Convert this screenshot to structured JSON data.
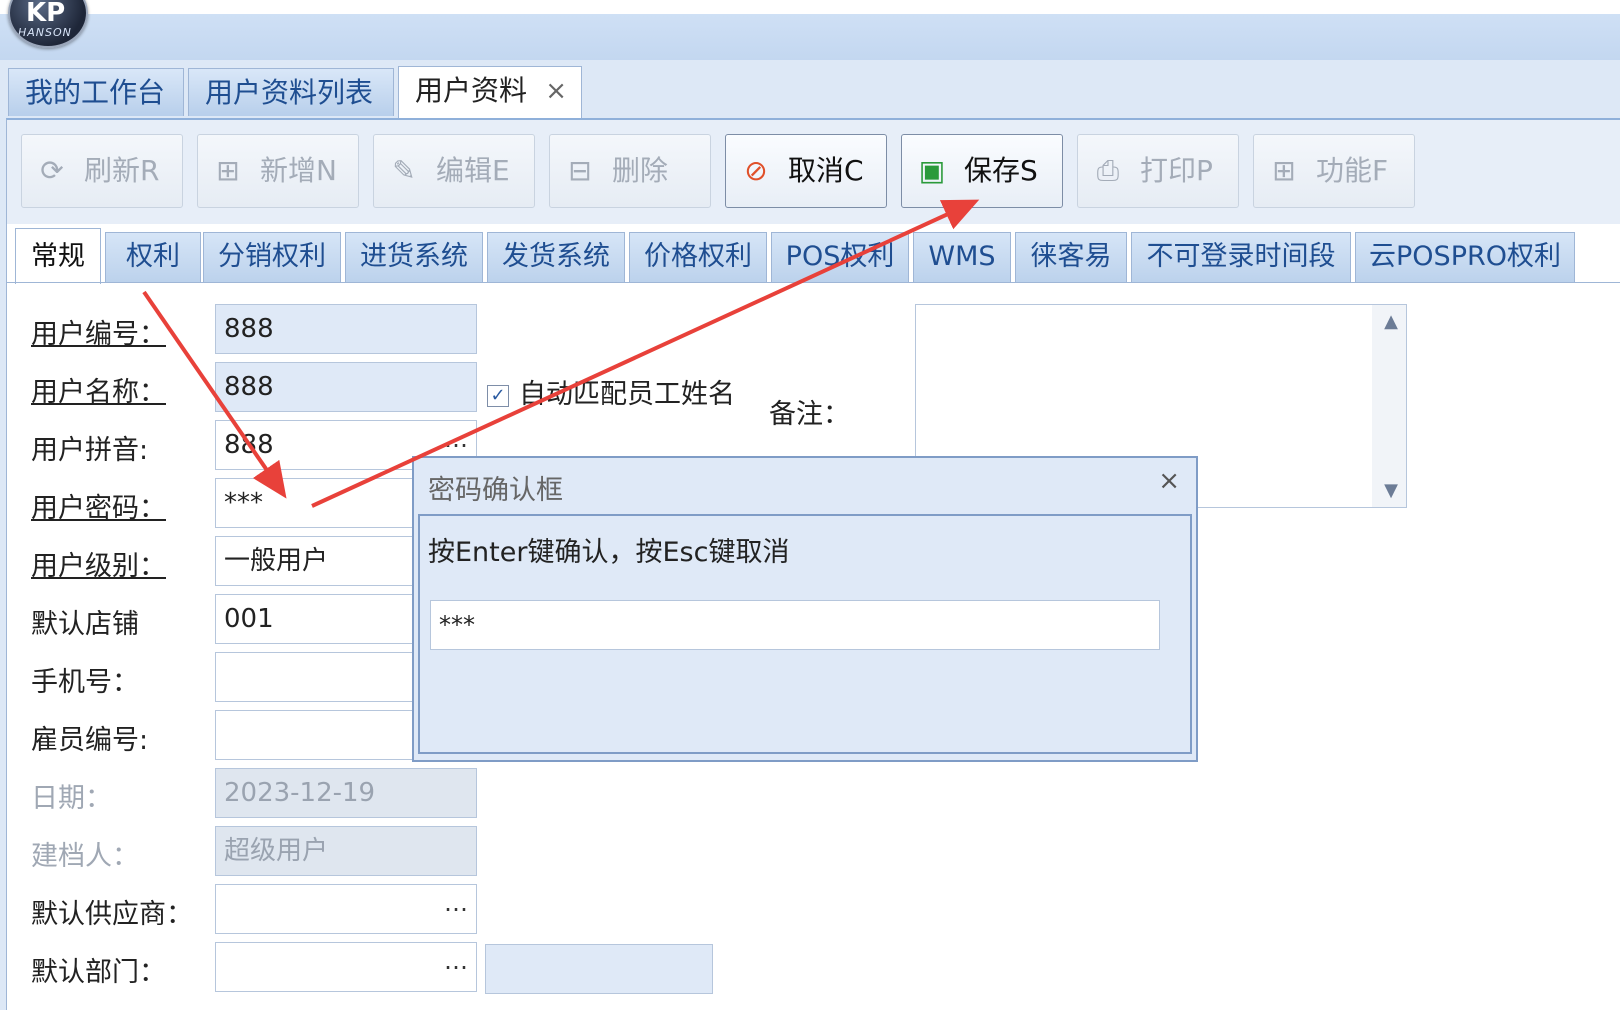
{
  "app": {
    "logo_text": "KP",
    "logo_sub": "HANSON"
  },
  "doc_tabs": [
    {
      "label": "我的工作台"
    },
    {
      "label": "用户资料列表"
    },
    {
      "label": "用户资料",
      "active": true,
      "close": "×"
    }
  ],
  "toolbar": {
    "buttons": [
      {
        "icon": "refresh-icon",
        "glyph": "⟳",
        "label": "刷新R",
        "enabled": false
      },
      {
        "icon": "add-icon",
        "glyph": "⊞",
        "label": "新增N",
        "enabled": false
      },
      {
        "icon": "edit-icon",
        "glyph": "✎",
        "label": "编辑E",
        "enabled": false
      },
      {
        "icon": "delete-icon",
        "glyph": "⊟",
        "label": "删除",
        "enabled": false
      },
      {
        "icon": "cancel-icon",
        "glyph": "⊘",
        "label": "取消C",
        "enabled": true,
        "color": "#e0502a"
      },
      {
        "icon": "save-icon",
        "glyph": "▣",
        "label": "保存S",
        "enabled": true,
        "color": "#2a9a3a"
      },
      {
        "icon": "print-icon",
        "glyph": "⎙",
        "label": "打印P",
        "enabled": false
      },
      {
        "icon": "function-icon",
        "glyph": "⊞",
        "label": "功能F",
        "enabled": false
      }
    ]
  },
  "form_tabs": [
    "常规",
    "权利",
    "分销权利",
    "进货系统",
    "发货系统",
    "价格权利",
    "POS权利",
    "WMS",
    "徕客易",
    "不可登录时间段",
    "云POSPRO权利"
  ],
  "form": {
    "fields": [
      {
        "label": "用户编号：",
        "value": "888",
        "style": "blue",
        "required": true
      },
      {
        "label": "用户名称：",
        "value": "888",
        "style": "blue",
        "required": true
      },
      {
        "label": "用户拼音:",
        "value": "888",
        "style": "white",
        "dots": "…"
      },
      {
        "label": "用户密码：",
        "value": "***",
        "style": "white",
        "required": true
      },
      {
        "label": "用户级别：",
        "value": "一般用户",
        "style": "white",
        "required": true
      },
      {
        "label": "默认店铺",
        "value": "001",
        "style": "white"
      },
      {
        "label": "手机号：",
        "value": "",
        "style": "white"
      },
      {
        "label": "雇员编号:",
        "value": "",
        "style": "white"
      },
      {
        "label": "日期：",
        "value": "2023-12-19",
        "style": "gray",
        "disabled": true
      },
      {
        "label": "建档人：",
        "value": "超级用户",
        "style": "gray",
        "disabled": true
      },
      {
        "label": "默认供应商：",
        "value": "",
        "style": "white",
        "dots": "…"
      },
      {
        "label": "默认部门：",
        "value": "",
        "style": "white",
        "dots": "…"
      }
    ],
    "auto_match": {
      "label": "自动匹配员工姓名",
      "checked": true,
      "mark": "✓"
    },
    "remark_label": "备注："
  },
  "dialog": {
    "title": "密码确认框",
    "close": "×",
    "message": "按Enter键确认，按Esc键取消",
    "password_value": "***"
  },
  "annotation": {
    "arrow_color": "#e8413a"
  }
}
